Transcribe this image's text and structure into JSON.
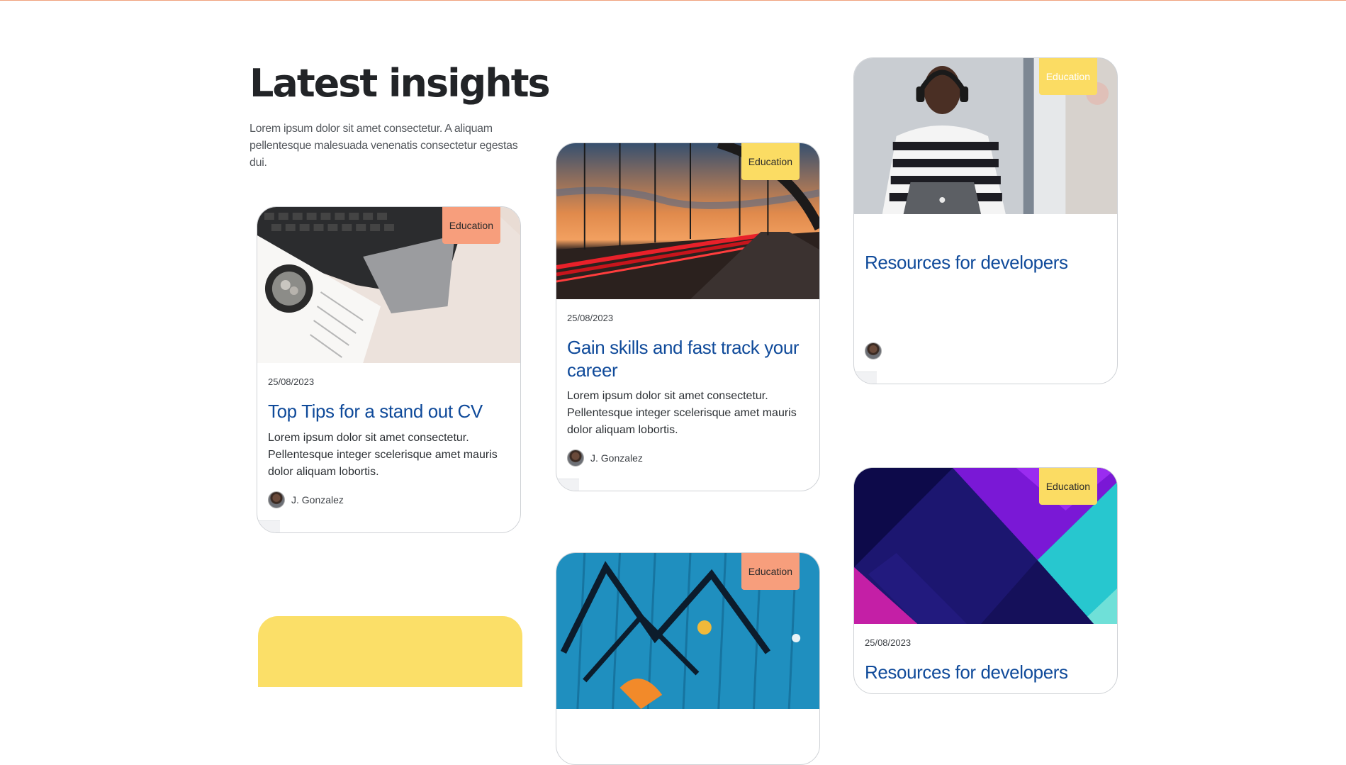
{
  "section": {
    "title": "Latest insights",
    "intro": "Lorem ipsum dolor sit amet consectetur. A aliquam pellentesque malesuada venenatis consectetur egestas dui."
  },
  "cards": [
    {
      "badge": "Education",
      "date": "25/08/2023",
      "title": "Top Tips for a stand out CV",
      "description": "Lorem ipsum dolor sit amet consectetur. Pellentesque integer scelerisque amet mauris dolor aliquam lobortis.",
      "author": "J. Gonzalez"
    },
    {
      "badge": "Education",
      "date": "25/08/2023",
      "title": "Gain skills and fast track your career",
      "description": "Lorem ipsum dolor sit amet consectetur. Pellentesque integer scelerisque amet mauris dolor aliquam lobortis.",
      "author": "J. Gonzalez"
    },
    {
      "badge": "Education",
      "title": "Resources for developers"
    },
    {
      "badge": "Education",
      "date": "25/08/2023",
      "title": "Resources for developers"
    },
    {
      "badge": "Education"
    }
  ],
  "colors": {
    "accent_orange": "#f79e7c",
    "accent_yellow": "#fbdc63",
    "title_blue": "#0f4a9a"
  }
}
